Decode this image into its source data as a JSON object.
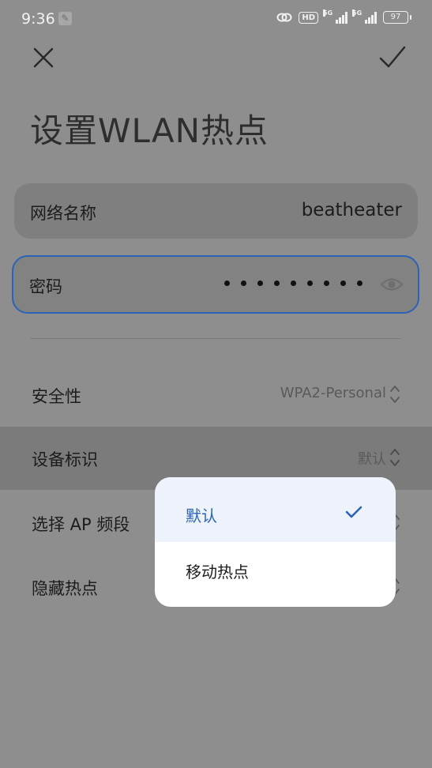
{
  "status_bar": {
    "time": "9:36",
    "hd": "HD",
    "net1": "5G",
    "net2": "5G",
    "battery": "97"
  },
  "header": {
    "title": "设置WLAN热点",
    "close_icon": "close-icon",
    "confirm_icon": "check-icon"
  },
  "network_name": {
    "label": "网络名称",
    "value": "beatheater"
  },
  "password": {
    "label": "密码",
    "masked_length": 9,
    "toggle_icon": "eye-icon"
  },
  "settings": [
    {
      "label": "安全性",
      "value": "WPA2-Personal"
    },
    {
      "label": "设备标识",
      "value": "默认"
    },
    {
      "label": "选择 AP 频段",
      "value": ""
    },
    {
      "label": "隐藏热点",
      "value": ""
    }
  ],
  "dropdown": {
    "options": [
      {
        "label": "默认",
        "selected": true
      },
      {
        "label": "移动热点",
        "selected": false
      }
    ]
  },
  "colors": {
    "accent": "#2c63b6",
    "overlay_bg": "#8e8e8e",
    "popup_bg": "#ffffff"
  }
}
